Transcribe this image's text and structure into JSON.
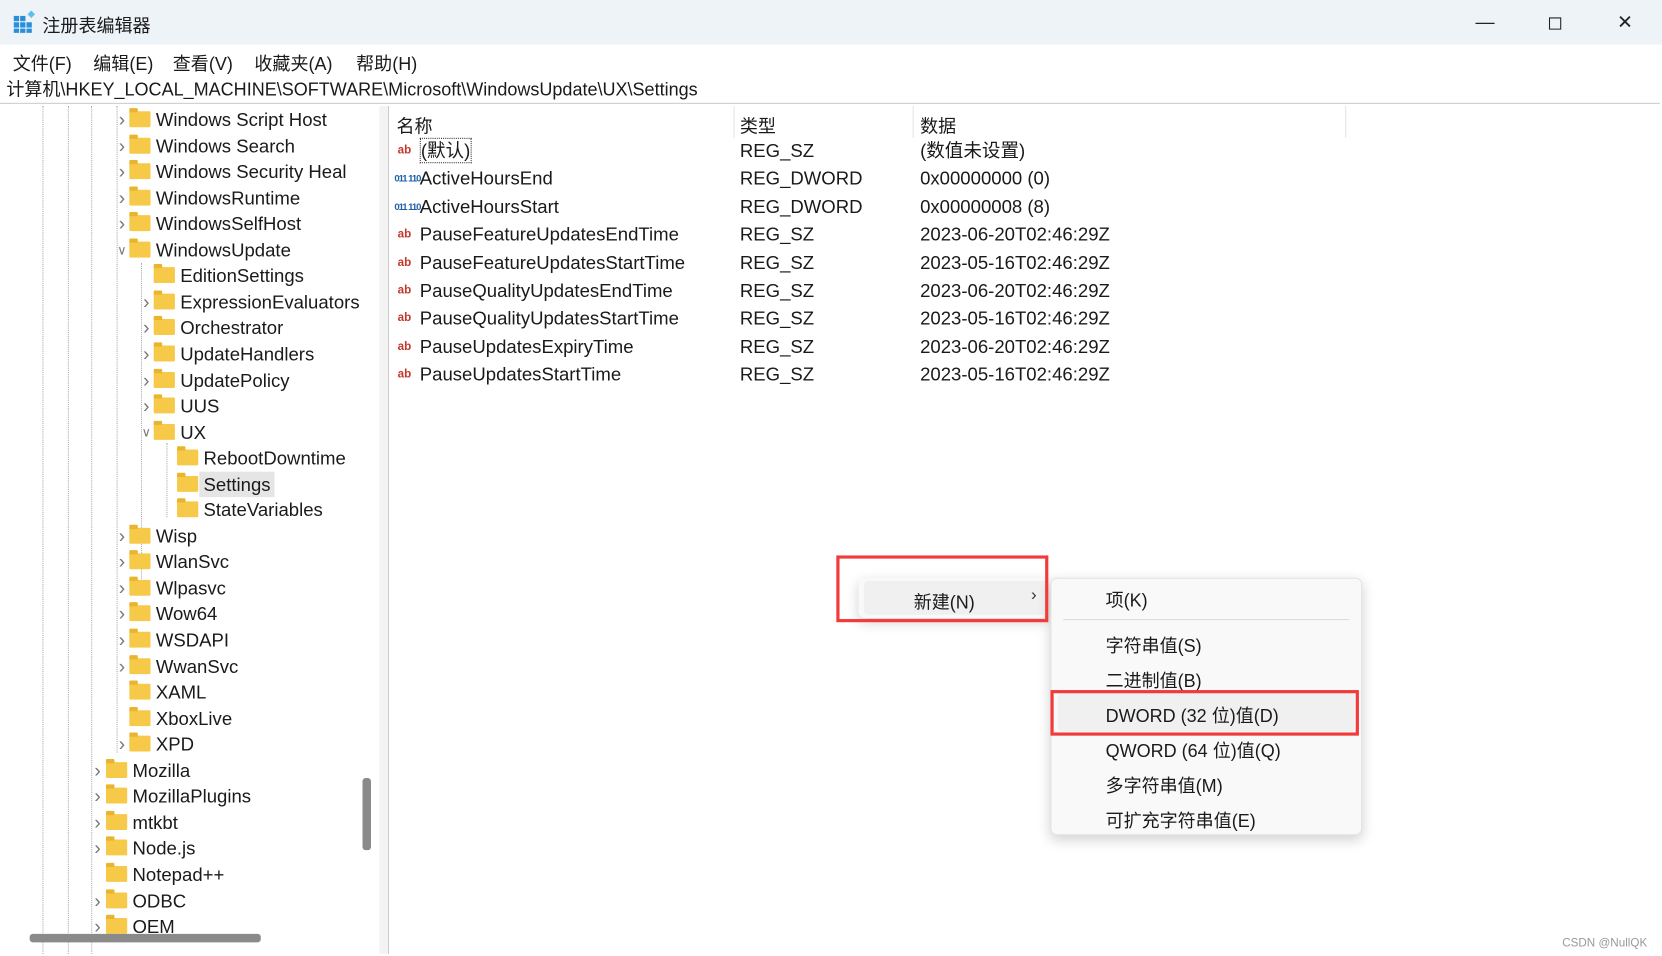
{
  "window": {
    "title": "注册表编辑器",
    "minimize_icon": "minimize-icon",
    "maximize_icon": "maximize-icon",
    "close_icon": "close-icon"
  },
  "menubar": [
    "文件(F)",
    "编辑(E)",
    "查看(V)",
    "收藏夹(A)",
    "帮助(H)"
  ],
  "address": "计算机\\HKEY_LOCAL_MACHINE\\SOFTWARE\\Microsoft\\WindowsUpdate\\UX\\Settings",
  "tree": [
    {
      "label": "Windows Script Host",
      "level": 1,
      "chevron": "right"
    },
    {
      "label": "Windows Search",
      "level": 1,
      "chevron": "right"
    },
    {
      "label": "Windows Security Heal",
      "level": 1,
      "chevron": "right"
    },
    {
      "label": "WindowsRuntime",
      "level": 1,
      "chevron": "right"
    },
    {
      "label": "WindowsSelfHost",
      "level": 1,
      "chevron": "right"
    },
    {
      "label": "WindowsUpdate",
      "level": 1,
      "chevron": "down"
    },
    {
      "label": "EditionSettings",
      "level": 2,
      "chevron": "none"
    },
    {
      "label": "ExpressionEvaluators",
      "level": 2,
      "chevron": "right"
    },
    {
      "label": "Orchestrator",
      "level": 2,
      "chevron": "right"
    },
    {
      "label": "UpdateHandlers",
      "level": 2,
      "chevron": "right"
    },
    {
      "label": "UpdatePolicy",
      "level": 2,
      "chevron": "right"
    },
    {
      "label": "UUS",
      "level": 2,
      "chevron": "right"
    },
    {
      "label": "UX",
      "level": 2,
      "chevron": "down"
    },
    {
      "label": "RebootDowntime",
      "level": 3,
      "chevron": "none"
    },
    {
      "label": "Settings",
      "level": 3,
      "chevron": "none",
      "selected": true
    },
    {
      "label": "StateVariables",
      "level": 3,
      "chevron": "none"
    },
    {
      "label": "Wisp",
      "level": 1,
      "chevron": "right"
    },
    {
      "label": "WlanSvc",
      "level": 1,
      "chevron": "right"
    },
    {
      "label": "Wlpasvc",
      "level": 1,
      "chevron": "right"
    },
    {
      "label": "Wow64",
      "level": 1,
      "chevron": "right"
    },
    {
      "label": "WSDAPI",
      "level": 1,
      "chevron": "right"
    },
    {
      "label": "WwanSvc",
      "level": 1,
      "chevron": "right"
    },
    {
      "label": "XAML",
      "level": 1,
      "chevron": "none"
    },
    {
      "label": "XboxLive",
      "level": 1,
      "chevron": "none"
    },
    {
      "label": "XPD",
      "level": 1,
      "chevron": "right"
    },
    {
      "label": "Mozilla",
      "level": 0,
      "chevron": "right"
    },
    {
      "label": "MozillaPlugins",
      "level": 0,
      "chevron": "right"
    },
    {
      "label": "mtkbt",
      "level": 0,
      "chevron": "right"
    },
    {
      "label": "Node.js",
      "level": 0,
      "chevron": "right"
    },
    {
      "label": "Notepad++",
      "level": 0,
      "chevron": "none"
    },
    {
      "label": "ODBC",
      "level": 0,
      "chevron": "right"
    },
    {
      "label": "OEM",
      "level": 0,
      "chevron": "right"
    }
  ],
  "list": {
    "headers": [
      "名称",
      "类型",
      "数据"
    ],
    "rows": [
      {
        "icon": "string-value-icon",
        "name": "(默认)",
        "type": "REG_SZ",
        "data": "(数值未设置)"
      },
      {
        "icon": "binary-value-icon",
        "name": "ActiveHoursEnd",
        "type": "REG_DWORD",
        "data": "0x00000000 (0)"
      },
      {
        "icon": "binary-value-icon",
        "name": "ActiveHoursStart",
        "type": "REG_DWORD",
        "data": "0x00000008 (8)"
      },
      {
        "icon": "string-value-icon",
        "name": "PauseFeatureUpdatesEndTime",
        "type": "REG_SZ",
        "data": "2023-06-20T02:46:29Z"
      },
      {
        "icon": "string-value-icon",
        "name": "PauseFeatureUpdatesStartTime",
        "type": "REG_SZ",
        "data": "2023-05-16T02:46:29Z"
      },
      {
        "icon": "string-value-icon",
        "name": "PauseQualityUpdatesEndTime",
        "type": "REG_SZ",
        "data": "2023-06-20T02:46:29Z"
      },
      {
        "icon": "string-value-icon",
        "name": "PauseQualityUpdatesStartTime",
        "type": "REG_SZ",
        "data": "2023-05-16T02:46:29Z"
      },
      {
        "icon": "string-value-icon",
        "name": "PauseUpdatesExpiryTime",
        "type": "REG_SZ",
        "data": "2023-06-20T02:46:29Z"
      },
      {
        "icon": "string-value-icon",
        "name": "PauseUpdatesStartTime",
        "type": "REG_SZ",
        "data": "2023-05-16T02:46:29Z"
      }
    ]
  },
  "context_menu": {
    "new_label": "新建(N)",
    "submenu": [
      "项(K)",
      "字符串值(S)",
      "二进制值(B)",
      "DWORD (32 位)值(D)",
      "QWORD (64 位)值(Q)",
      "多字符串值(M)",
      "可扩充字符串值(E)"
    ],
    "highlighted": "DWORD (32 位)值(D)"
  },
  "annotation_color": "#f23a3a",
  "watermark": "CSDN @NullQK"
}
